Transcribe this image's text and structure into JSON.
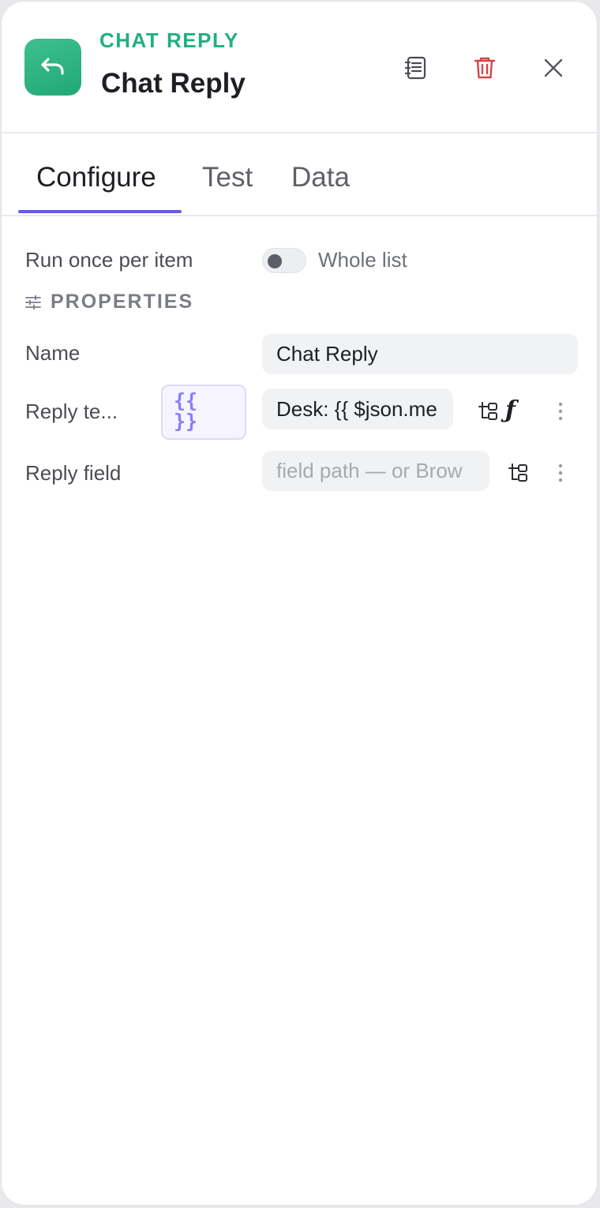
{
  "header": {
    "node_type": "CHAT REPLY",
    "node_title": "Chat Reply",
    "icons": {
      "node": "reply-arrow-icon",
      "notes": "notes-icon",
      "delete": "trash-icon",
      "close": "close-icon"
    },
    "colors": {
      "node_icon_bg": "#2fb584",
      "node_type_text": "#22b07d",
      "delete_icon": "#d64545"
    }
  },
  "tabs": {
    "items": [
      {
        "label": "Configure",
        "active": true
      },
      {
        "label": "Test",
        "active": false
      },
      {
        "label": "Data",
        "active": false
      }
    ],
    "active_color": "#6a5be0"
  },
  "run_mode": {
    "label": "Run once per item",
    "toggle_label": "Whole list",
    "toggle_on": false
  },
  "properties": {
    "section_label": "PROPERTIES",
    "section_icon": "sliders-icon",
    "fields": {
      "name": {
        "label": "Name",
        "value": "Chat Reply"
      },
      "reply_template": {
        "label": "Reply te...",
        "expr_open": "{{",
        "expr_close": "}}",
        "value": "Desk: {{ $json.me",
        "fx_label": "ƒ"
      },
      "reply_field": {
        "label": "Reply field",
        "placeholder": "field path — or Brow"
      }
    }
  }
}
